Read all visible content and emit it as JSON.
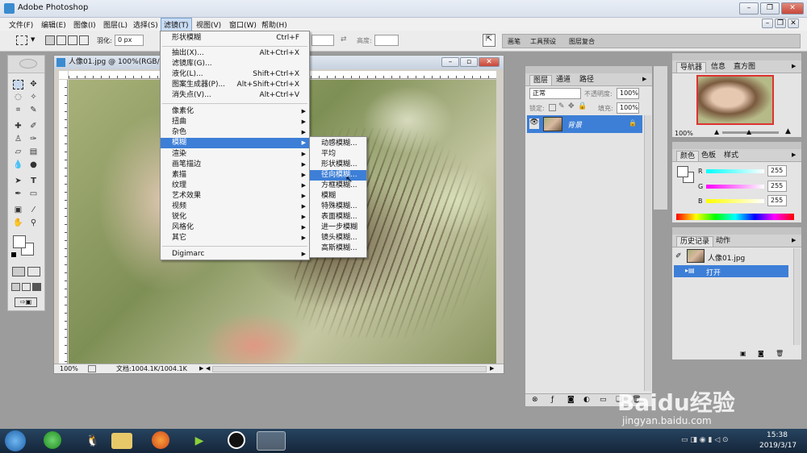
{
  "app": {
    "title": "Adobe Photoshop"
  },
  "menubar": {
    "items": [
      "文件(F)",
      "编辑(E)",
      "图像(I)",
      "图层(L)",
      "选择(S)",
      "滤镜(T)",
      "视图(V)",
      "窗口(W)",
      "帮助(H)"
    ]
  },
  "options": {
    "feather_label": "羽化:",
    "feather_value": "0 px",
    "height_label": "高度:",
    "wells": [
      "画笔",
      "工具预设",
      "图层复合"
    ]
  },
  "document": {
    "title": "人像01.jpg @ 100%(RGB/8)",
    "zoom": "100%",
    "doc_info": "文档:1004.1K/1004.1K"
  },
  "filter_menu": {
    "items": [
      {
        "label": "形状模糊",
        "shortcut": "Ctrl+F"
      },
      {
        "label": "抽出(X)...",
        "shortcut": "Alt+Ctrl+X"
      },
      {
        "label": "滤镜库(G)...",
        "shortcut": ""
      },
      {
        "label": "液化(L)...",
        "shortcut": "Shift+Ctrl+X"
      },
      {
        "label": "图案生成器(P)...",
        "shortcut": "Alt+Shift+Ctrl+X"
      },
      {
        "label": "消失点(V)...",
        "shortcut": "Alt+Ctrl+V"
      },
      {
        "label": "像素化",
        "shortcut": ""
      },
      {
        "label": "扭曲",
        "shortcut": ""
      },
      {
        "label": "杂色",
        "shortcut": ""
      },
      {
        "label": "模糊",
        "shortcut": ""
      },
      {
        "label": "渲染",
        "shortcut": ""
      },
      {
        "label": "画笔描边",
        "shortcut": ""
      },
      {
        "label": "素描",
        "shortcut": ""
      },
      {
        "label": "纹理",
        "shortcut": ""
      },
      {
        "label": "艺术效果",
        "shortcut": ""
      },
      {
        "label": "视频",
        "shortcut": ""
      },
      {
        "label": "锐化",
        "shortcut": ""
      },
      {
        "label": "风格化",
        "shortcut": ""
      },
      {
        "label": "其它",
        "shortcut": ""
      },
      {
        "label": "Digimarc",
        "shortcut": ""
      }
    ]
  },
  "blur_submenu": {
    "items": [
      "动感模糊...",
      "平均",
      "形状模糊...",
      "径向模糊...",
      "方框模糊...",
      "模糊",
      "特殊模糊...",
      "表面模糊...",
      "进一步模糊",
      "镜头模糊...",
      "高斯模糊..."
    ],
    "highlighted": "径向模糊..."
  },
  "layers_panel": {
    "tabs": [
      "图层",
      "通道",
      "路径"
    ],
    "blend_mode": "正常",
    "opacity_label": "不透明度:",
    "opacity_value": "100%",
    "lock_label": "锁定:",
    "fill_label": "填充:",
    "fill_value": "100%",
    "layer_name": "背景"
  },
  "navigator_panel": {
    "tabs": [
      "导航器",
      "信息",
      "直方图"
    ],
    "zoom": "100%"
  },
  "color_panel": {
    "tabs": [
      "颜色",
      "色板",
      "样式"
    ],
    "r_label": "R",
    "r_value": "255",
    "g_label": "G",
    "g_value": "255",
    "b_label": "B",
    "b_value": "255"
  },
  "history_panel": {
    "tabs": [
      "历史记录",
      "动作"
    ],
    "snapshot": "人像01.jpg",
    "step": "打开"
  },
  "watermark": {
    "brand": "Baidu经验",
    "url": "jingyan.baidu.com"
  },
  "taskbar": {
    "time": "15:38",
    "date": "2019/3/17"
  },
  "colors": {
    "menu_highlight": "#3d7fd7",
    "taskbar": "#1c3348"
  }
}
